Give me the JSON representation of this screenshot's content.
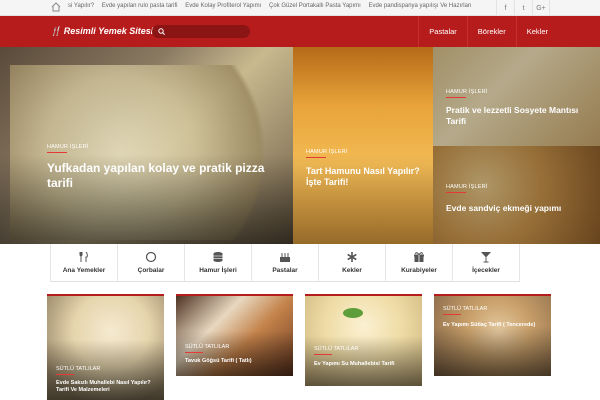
{
  "topbar": {
    "ticker": [
      "si Yapılır?",
      "Evde yapılan rulo pasta tarifi",
      "Evde Kolay Profiterol Yapımı",
      "Çok Güzel Portakallı Pasta Yapımı",
      "Evde pandispanya yapılışı Ve Hazırlan"
    ],
    "socials": [
      "f",
      "t",
      "G+"
    ]
  },
  "header": {
    "logo": "Resimli Yemek Sitesi",
    "nav": [
      "Pastalar",
      "Börekler",
      "Kekler"
    ],
    "accent": "#b71c1c"
  },
  "hero": [
    {
      "badge": "HAMUR İŞLERİ",
      "title": "Yufkadan yapılan kolay ve pratik pizza tarifi"
    },
    {
      "badge": "HAMUR İŞLERİ",
      "title": "Tart Hamunu Nasıl Yapılır? İşte Tarifi!"
    },
    {
      "badge": "HAMUR İŞLERİ",
      "title": "Pratik ve lezzetli Sosyete Mantısı Tarifi"
    },
    {
      "badge": "HAMUR İŞLERİ",
      "title": "Evde sandviç ekmeği yapımı"
    }
  ],
  "categories": [
    {
      "label": "Ana Yemekler",
      "icon": "fork-knife-icon"
    },
    {
      "label": "Çorbalar",
      "icon": "bowl-icon"
    },
    {
      "label": "Hamur İşleri",
      "icon": "stack-icon"
    },
    {
      "label": "Pastalar",
      "icon": "cake-icon"
    },
    {
      "label": "Kekler",
      "icon": "asterisk-icon"
    },
    {
      "label": "Kurabiyeler",
      "icon": "gift-icon"
    },
    {
      "label": "İçecekler",
      "icon": "glass-icon"
    }
  ],
  "cards": [
    {
      "badge": "SÜTLÜ TATLILAR",
      "title": "Evde Sakızlı Muhallebi Nasıl Yapılır? Tarifi Ve Malzemeleri"
    },
    {
      "badge": "SÜTLÜ TATLILAR",
      "title": "Tavuk Göğsü Tarifi ( Tatlı)"
    },
    {
      "badge": "SÜTLÜ TATLILAR",
      "title": "Ev Yapımı Su Muhallebisi Tarifi"
    },
    {
      "badge": "SÜTLÜ TATLILAR",
      "title": "Ev Yapımı Sütlaç Tarifi ( Tencerede)"
    }
  ]
}
